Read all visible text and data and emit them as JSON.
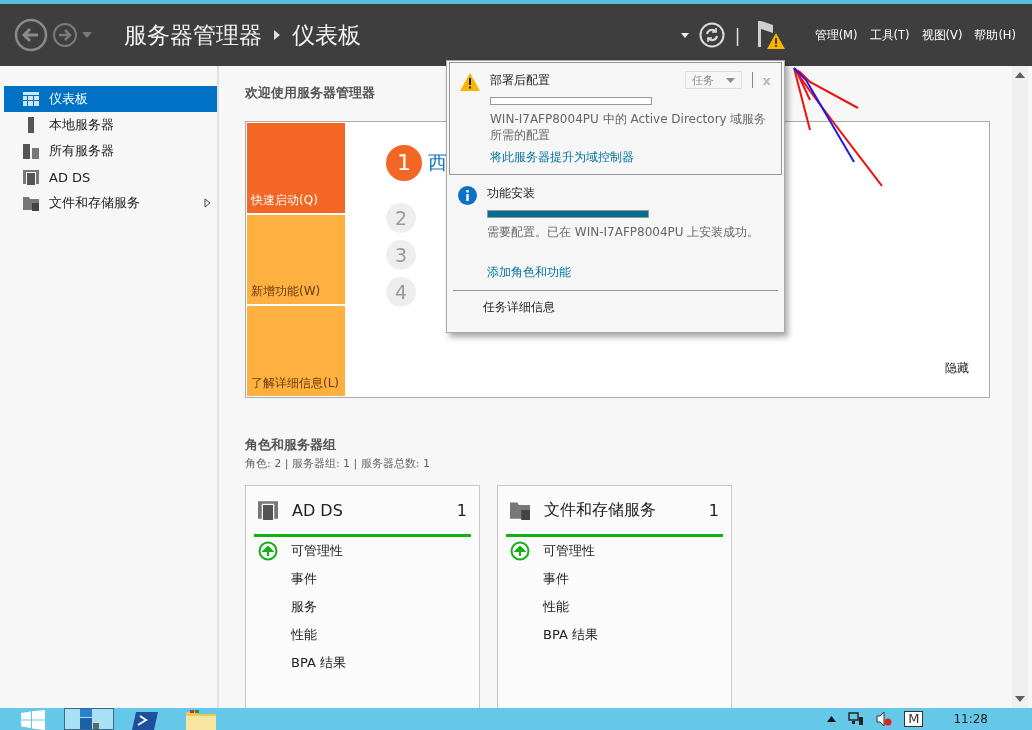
{
  "header": {
    "breadcrumb": [
      "服务器管理器",
      "仪表板"
    ],
    "menus": [
      "管理(M)",
      "工具(T)",
      "视图(V)",
      "帮助(H)"
    ],
    "separator": "|"
  },
  "sidebar": {
    "items": [
      {
        "label": "仪表板",
        "kind": "dashboard",
        "selected": true,
        "expandable": false
      },
      {
        "label": "本地服务器",
        "kind": "server",
        "selected": false,
        "expandable": false
      },
      {
        "label": "所有服务器",
        "kind": "servers",
        "selected": false,
        "expandable": false
      },
      {
        "label": "AD DS",
        "kind": "adds",
        "selected": false,
        "expandable": false
      },
      {
        "label": "文件和存储服务",
        "kind": "files",
        "selected": false,
        "expandable": true
      }
    ]
  },
  "welcome": {
    "title": "欢迎使用服务器管理器",
    "tiles": [
      {
        "label": "快速启动(Q)",
        "selected": true
      },
      {
        "label": "新增功能(W)",
        "selected": false
      },
      {
        "label": "了解详细信息(L)",
        "selected": false
      }
    ],
    "steps": [
      {
        "number": "1",
        "text": "西",
        "selected": true
      },
      {
        "number": "2",
        "selected": false
      },
      {
        "number": "3",
        "selected": false
      },
      {
        "number": "4",
        "selected": false
      }
    ],
    "hide": "隐藏"
  },
  "roles": {
    "title": "角色和服务器组",
    "summary": "角色: 2 | 服务器组: 1 | 服务器总数: 1",
    "cards": [
      {
        "name": "AD DS",
        "kind": "adds",
        "count": "1",
        "color": "#13b113",
        "items": [
          "可管理性",
          "事件",
          "服务",
          "性能",
          "BPA 结果"
        ]
      },
      {
        "name": "文件和存储服务",
        "kind": "files",
        "count": "1",
        "color": "#13b113",
        "items": [
          "可管理性",
          "事件",
          "性能",
          "BPA 结果"
        ]
      }
    ]
  },
  "notifications": {
    "tasks_button": {
      "label": "任务",
      "disabled": true
    },
    "close": "x",
    "items": [
      {
        "kind": "warning",
        "title": "部署后配置",
        "level": 0,
        "message": "WIN-I7AFP8004PU 中的 Active Directory 域服务所需的配置",
        "link": "将此服务器提升为域控制器",
        "selected": true
      },
      {
        "kind": "info",
        "title": "功能安装",
        "level": 1,
        "message": "需要配置。已在 WIN-I7AFP8004PU 上安装成功。",
        "link": "添加角色和功能",
        "selected": false
      }
    ],
    "footer": "任务详细信息"
  },
  "taskbar": {
    "ime": "M",
    "time": "11:28"
  }
}
